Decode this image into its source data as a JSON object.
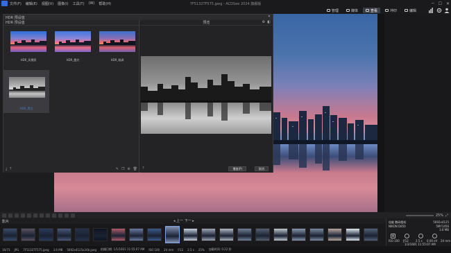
{
  "menubar": {
    "items": [
      "文件(F)",
      "编辑(E)",
      "视图(V)",
      "图像(I)",
      "工具(T)",
      "(W)",
      "帮助(H)"
    ],
    "title": "7F5132TF575.jpeg - ACDSee 2024 旗舰版"
  },
  "modes": [
    {
      "label": "管理",
      "active": false
    },
    {
      "label": "媒体",
      "active": false
    },
    {
      "label": "查看",
      "active": true
    },
    {
      "label": "冲印",
      "active": false
    },
    {
      "label": "编辑",
      "active": false
    }
  ],
  "hdr_window": {
    "title": "HDR 预设值",
    "presets_header": "HDR 预设值",
    "preview_header": "预览",
    "presets": [
      {
        "label": "HDR_风景照",
        "selected": false
      },
      {
        "label": "HDR_霞光",
        "selected": false
      },
      {
        "label": "HDR_暗调",
        "selected": false
      },
      {
        "label": "HDR_黑白",
        "selected": true
      }
    ],
    "apply_label": "播放(P)",
    "cancel_label": "取消"
  },
  "bottom_toolbar": {
    "zoom": "25%"
  },
  "filmstrip": {
    "header": "影片",
    "pager": "◂ 上一 下一 ▸",
    "thumb_colors": [
      "#3a4a6a",
      "#5a5060",
      "#2a3a5a",
      "#4a5878",
      "#25324a",
      "#0e1320",
      "#b05a6a",
      "#6a7aa0",
      "#3a5a8a",
      "#8090b0",
      "#c9d3e0",
      "#a0a8b8",
      "#b0b8c8",
      "#708098",
      "#556070",
      "#c0c8d0",
      "#8898b0",
      "#7a8aa0",
      "#b9a8a0",
      "#e0e8f0",
      "#506078"
    ]
  },
  "info": {
    "camera_title": "佳能 数码相机",
    "model": "NIKON D850",
    "right_1": "5MY1456",
    "right_2": "3.6 MB",
    "mode_label": "M",
    "iso": "ISO 100",
    "aperture": "ƒ/12",
    "shutter": "2.5 s",
    "ev": "0.00 eV",
    "focal": "24 mm",
    "time": "1/3/1601 11:55:07 AM",
    "dims": "5692x4125"
  },
  "statusbar": {
    "items": [
      "16/73",
      "JPG",
      "7F5132TF575.jpeg",
      "3.6 MB",
      "5692x4125x24b.jpeg",
      "拍摄日期: 1/1/1601 11:55:07 AM",
      "ISO 100",
      "24 mm",
      "f/12",
      "2.5 s",
      "25%",
      "加载时间: 0.22 秒"
    ]
  }
}
